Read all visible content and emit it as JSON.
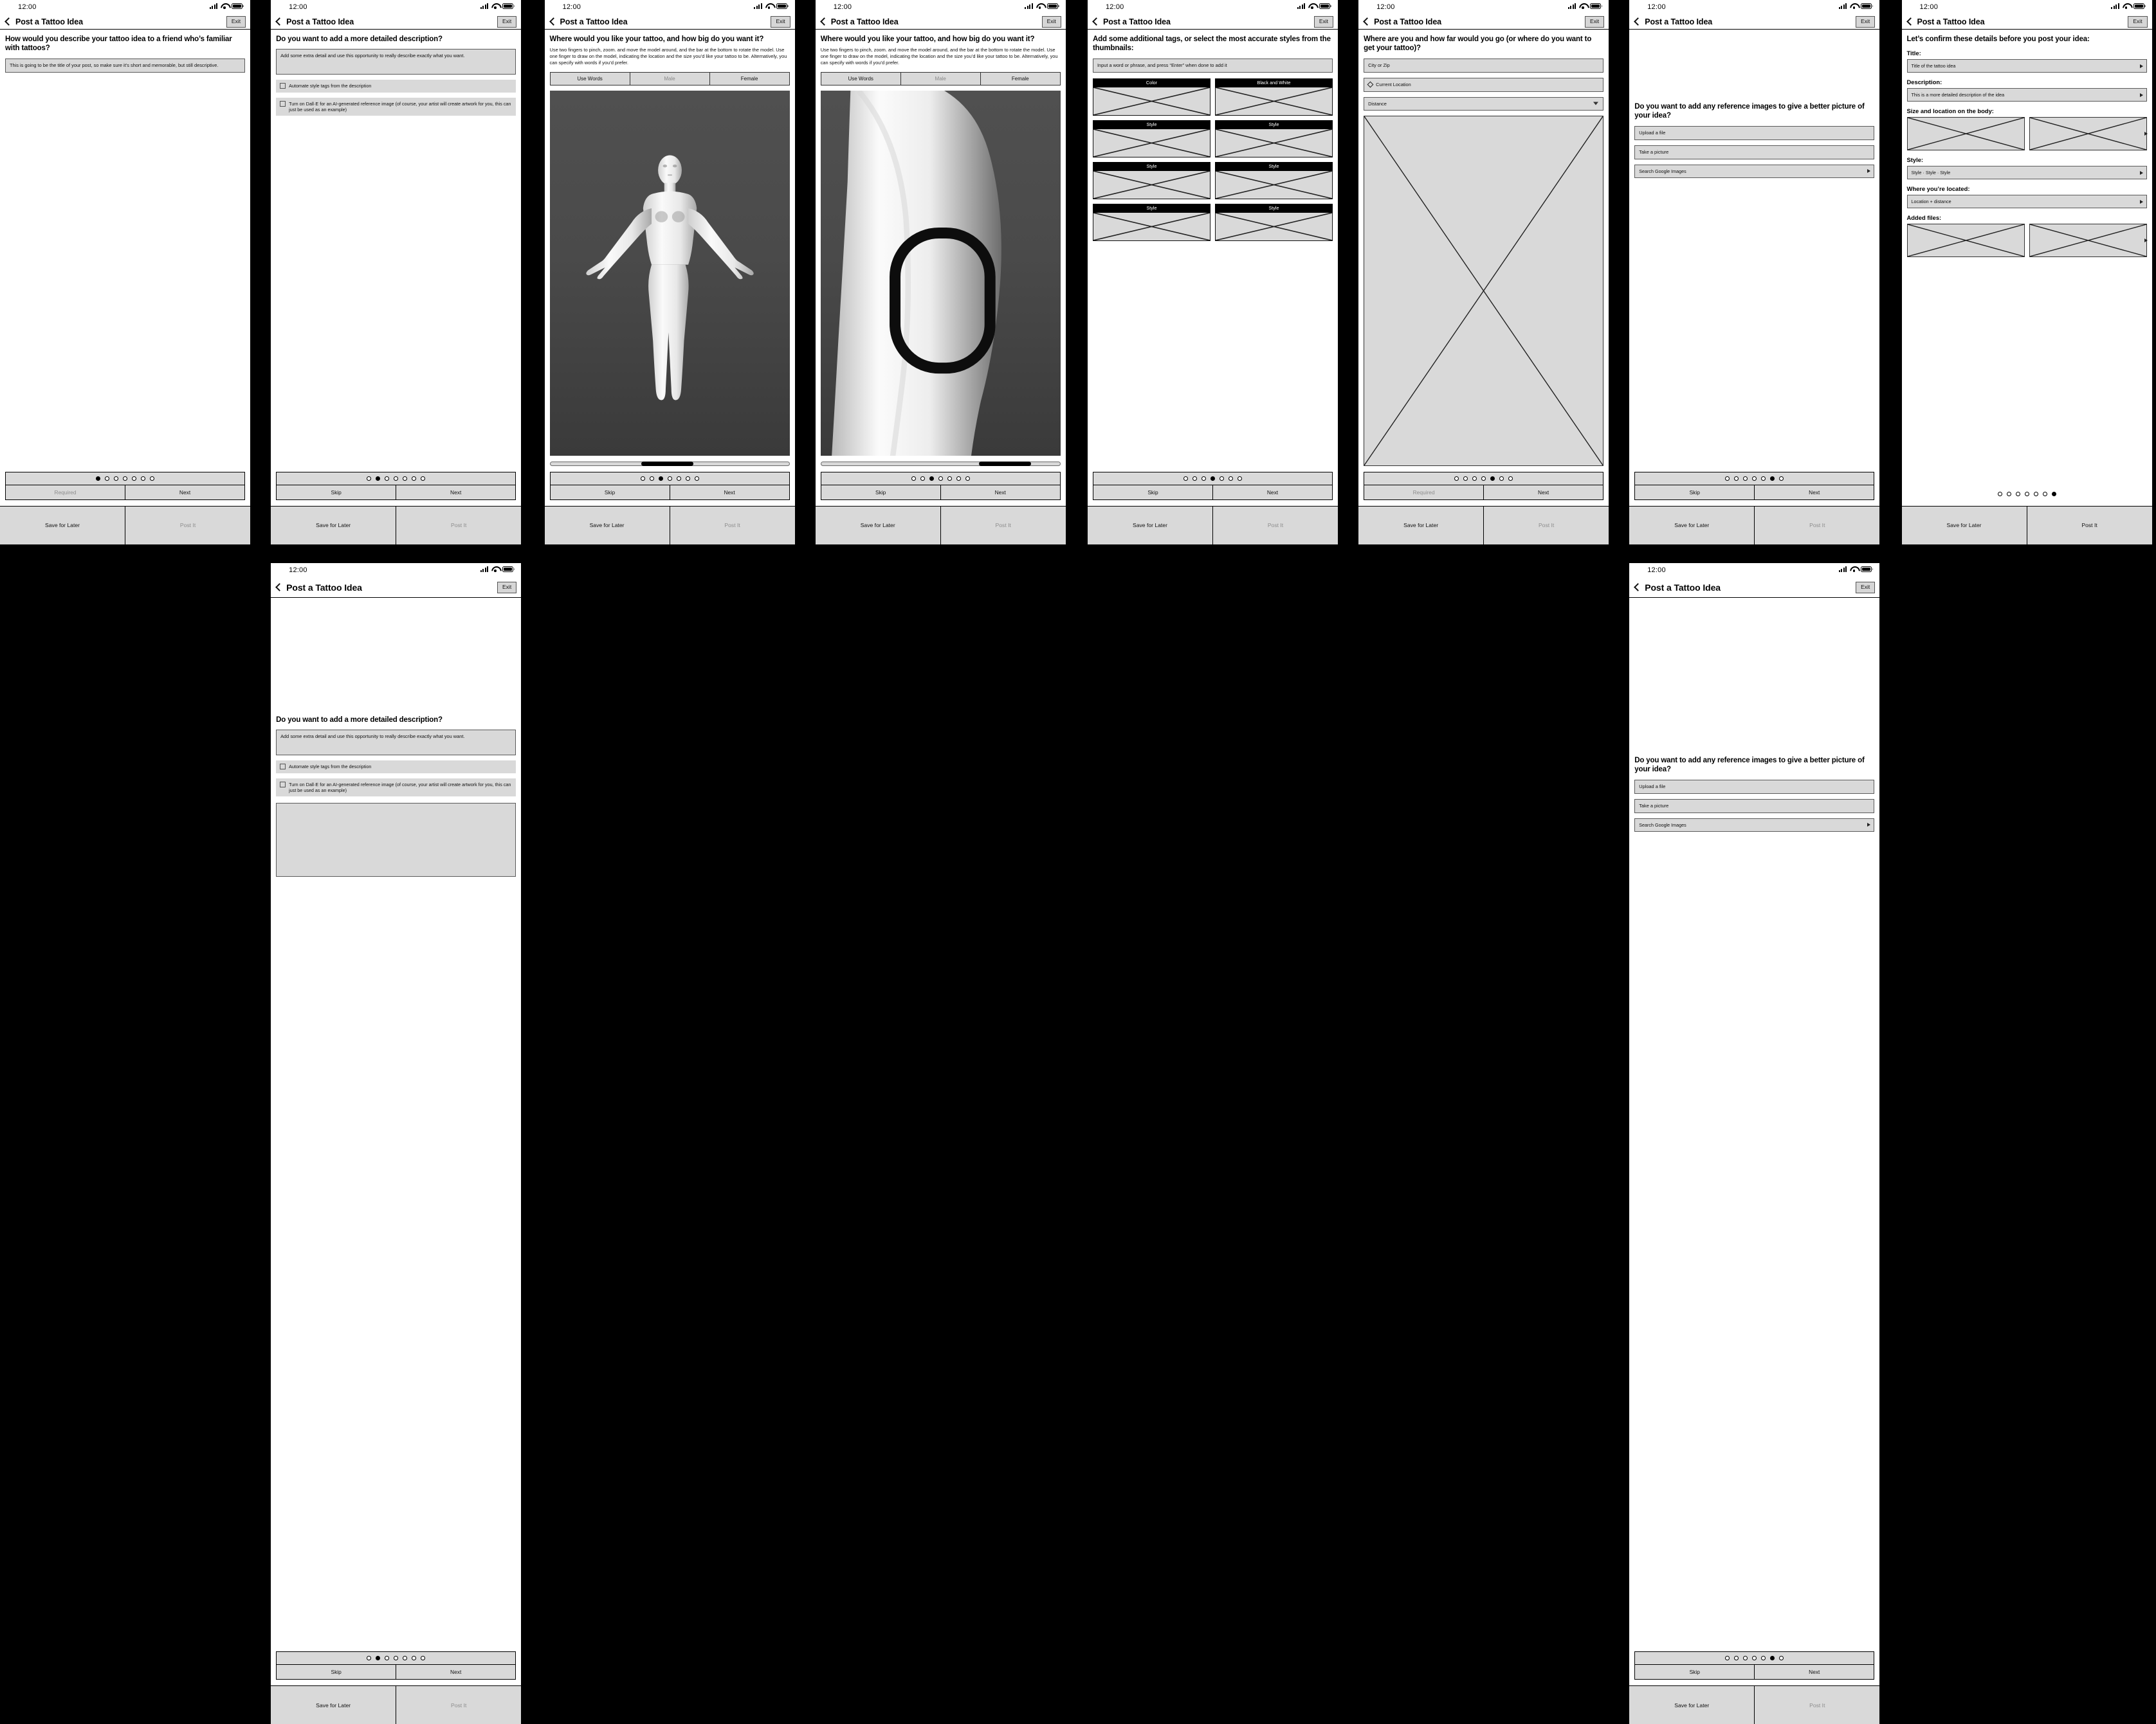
{
  "common": {
    "status_time": "12:00",
    "nav_title": "Post a Tattoo Idea",
    "exit_label": "Exit",
    "skip_label": "Skip",
    "next_label": "Next",
    "required_label": "Required",
    "save_label": "Save for Later",
    "post_label": "Post It",
    "total_steps": 7
  },
  "screens": [
    {
      "id": "title-step",
      "step": 1,
      "heading": "How would you describe your tattoo idea to a friend who’s familiar with tattoos?",
      "field_text": "This is going to be the title of your post, so make sure it’s short and memorable, but still descriptive.",
      "left_action": "Required",
      "left_action_dim": true
    },
    {
      "id": "description-step",
      "step": 2,
      "heading": "Do you want to add a more detailed description?",
      "field_text": "Add some extra detail and use this opportunity to really describe exactly what you want.",
      "checkbox_1": "Automate style tags from the description",
      "checkbox_2": "Turn on Dall·E for an AI-generated reference image (of course, your artist will create artwork for you, this can just be used as an example)",
      "left_action": "Skip",
      "left_action_dim": false
    },
    {
      "id": "body-location-step",
      "step": 3,
      "heading": "Where would you like your tattoo, and how big do you want it?",
      "subtext": "Use two fingers to pinch, zoom. and move the model around, and the bar at the bottom to rotate the model. Use one finger to draw on the model, indicating the location and the size you’d like your tattoo to be. Alternatively, you can specify with words if you’d prefer.",
      "segments": [
        "Use Words",
        "Male",
        "Female"
      ],
      "segment_dim_index": 1,
      "model_pose": "full-body-front",
      "rotation_percent": 45,
      "left_action": "Skip",
      "left_action_dim": false
    },
    {
      "id": "body-location-zoomed-step",
      "step": 4,
      "heading": "Where would you like your tattoo, and how big do you want it?",
      "subtext": "Use two fingers to pinch, zoom. and move the model around, and the bar at the bottom to rotate the model. Use one finger to draw on the model, indicating the location and the size you’d like your tattoo to be. Alternatively, you can specify with words if you’d prefer.",
      "segments": [
        "Use Words",
        "Male",
        "Female"
      ],
      "segment_dim_index": 1,
      "model_pose": "leg-zoomed-with-marking",
      "rotation_percent": 80,
      "left_action": "Skip",
      "left_action_dim": false
    },
    {
      "id": "tags-step",
      "step": 5,
      "heading": "Add some additional tags, or select the most accurate styles from the thumbnails:",
      "input_placeholder": "Input a word or phrase, and press “Enter” when done to add it",
      "thumbnails": [
        "Color",
        "Black and White",
        "Style",
        "Style",
        "Style",
        "Style",
        "Style",
        "Style"
      ],
      "left_action": "Skip",
      "left_action_dim": false
    },
    {
      "id": "geo-step",
      "step": 6,
      "heading": "Where are you and how far would you go (or where do you want to get your tattoo)?",
      "city_placeholder": "City or Zip",
      "current_location_label": "Current Location",
      "distance_label": "Distance",
      "map_placeholder": "map-placeholder",
      "left_action": "Required",
      "left_action_dim": true
    },
    {
      "id": "reference-images-step",
      "step": 6,
      "heading": "Do you want to add any reference images to give a better picture of your idea?",
      "upload_label": "Upload a file",
      "camera_label": "Take a picture",
      "google_label": "Search Google Images",
      "left_action": "Skip",
      "left_action_dim": false
    },
    {
      "id": "confirm-step",
      "step": 7,
      "heading": "Let’s confirm these details before you post your idea:",
      "labels": {
        "title": "Title:",
        "description": "Description:",
        "size_location": "Size and location on the body:",
        "style": "Style:",
        "located": "Where you’re located:",
        "files": "Added files:"
      },
      "values": {
        "title": "Title of the tattoo idea",
        "description": "This is a more detailed description of the idea",
        "style": "Style · Style · Style",
        "located": "Location + distance"
      },
      "post_enabled": true
    }
  ],
  "bottom_row": [
    {
      "id": "description-step-expanded",
      "step": 2,
      "heading": "Do you want to add a more detailed description?",
      "field_text": "Add some extra detail and use this opportunity to really describe exactly what you want.",
      "checkbox_1": "Automate style tags from the description",
      "checkbox_2": "Turn on Dall·E for an AI-generated reference image (of course, your artist will create artwork for you, this can just be used as an example)"
    },
    {
      "id": "reference-images-step-expanded",
      "step": 6,
      "heading": "Do you want to add any reference images to give a better picture of your idea?",
      "upload_label": "Upload a file",
      "camera_label": "Take a picture",
      "google_label": "Search Google Images"
    }
  ]
}
